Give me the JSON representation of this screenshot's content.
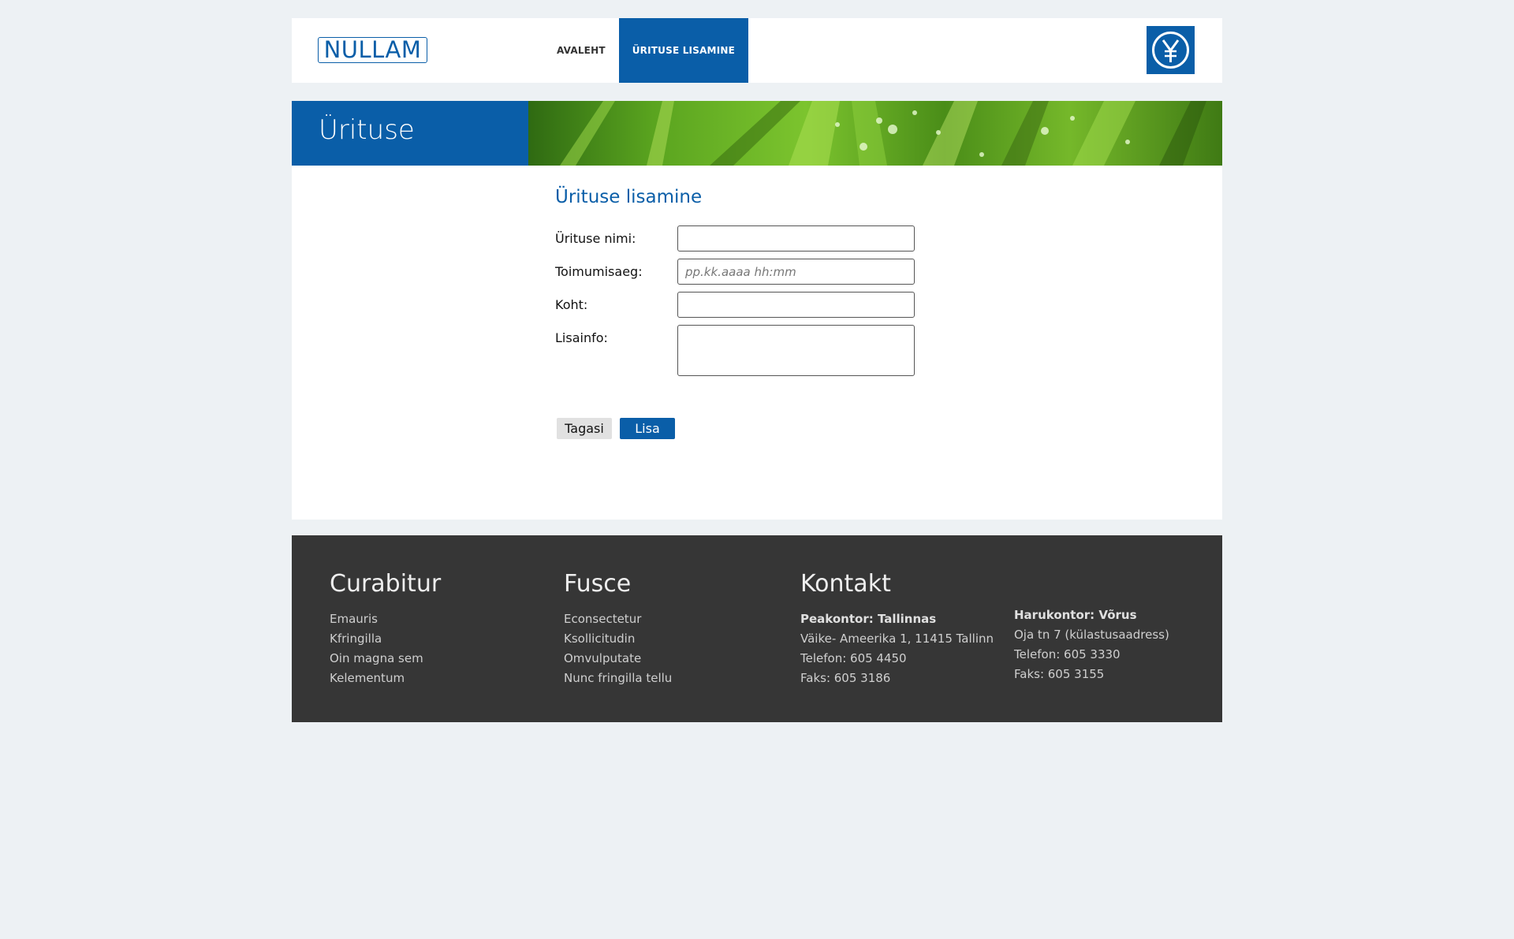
{
  "header": {
    "logo_text": "NULLAM",
    "nav": [
      {
        "label": "AVALEHT",
        "active": false
      },
      {
        "label": "ÜRITUSE LISAMINE",
        "active": true
      }
    ],
    "brand_icon": "yen-coin-icon"
  },
  "banner": {
    "title": "Ürituse lisamine"
  },
  "form": {
    "title": "Ürituse lisamine",
    "fields": {
      "name": {
        "label": "Ürituse nimi:",
        "value": "",
        "placeholder": ""
      },
      "time": {
        "label": "Toimumisaeg:",
        "value": "",
        "placeholder": "pp.kk.aaaa hh:mm"
      },
      "place": {
        "label": "Koht:",
        "value": "",
        "placeholder": ""
      },
      "info": {
        "label": "Lisainfo:",
        "value": "",
        "placeholder": ""
      }
    },
    "back_label": "Tagasi",
    "add_label": "Lisa"
  },
  "footer": {
    "col1": {
      "title": "Curabitur",
      "items": [
        "Emauris",
        "Kfringilla",
        "Oin magna sem",
        "Kelementum"
      ]
    },
    "col2": {
      "title": "Fusce",
      "items": [
        "Econsectetur",
        "Ksollicitudin",
        "Omvulputate",
        "Nunc fringilla tellu"
      ]
    },
    "col3": {
      "title": "Kontakt",
      "items": [
        "Peakontor: Tallinnas",
        "Väike- Ameerika 1, 11415 Tallinn",
        "Telefon: 605 4450",
        "Faks: 605 3186"
      ]
    },
    "col4": {
      "items": [
        "Harukontor: Võrus",
        "Oja tn 7 (külastusaadress)",
        "Telefon: 605 3330",
        "Faks: 605 3155"
      ]
    }
  },
  "colors": {
    "brand": "#0a5ea8",
    "background": "#edf1f4",
    "footer": "#363636"
  }
}
